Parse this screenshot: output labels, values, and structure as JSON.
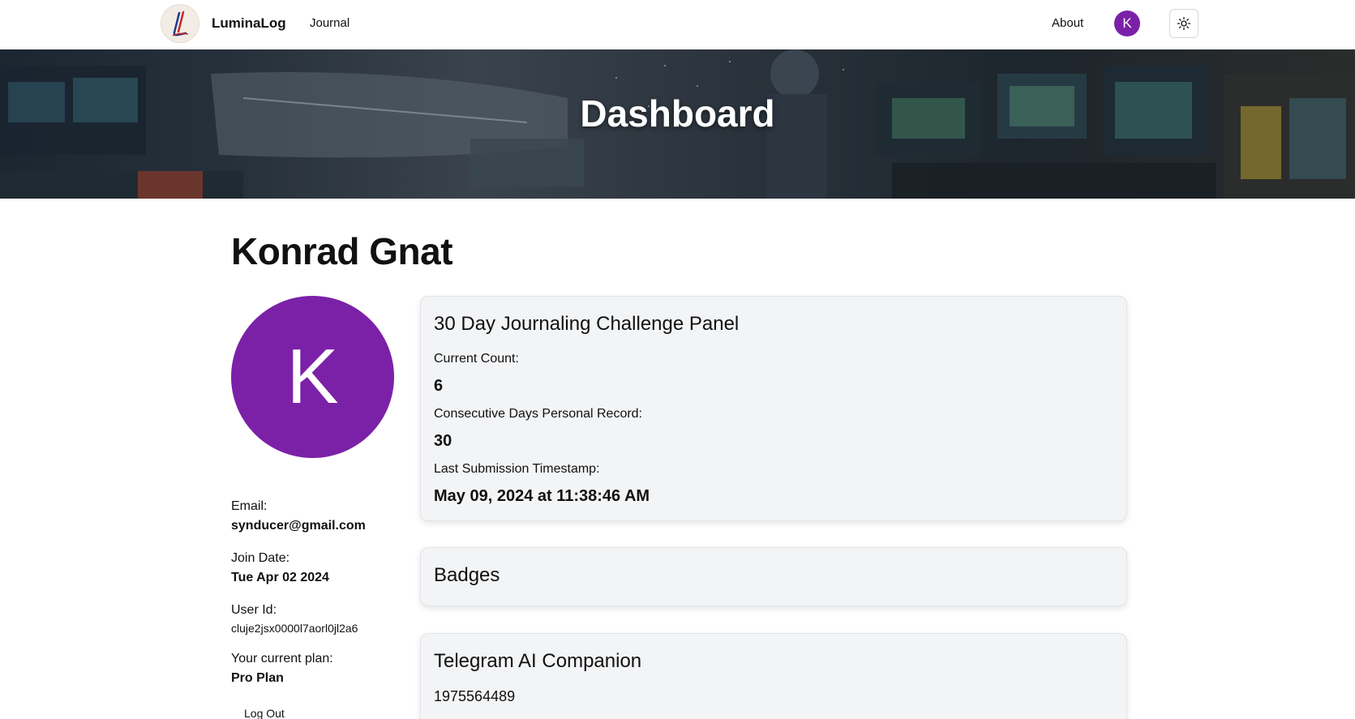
{
  "nav": {
    "brand": "LuminaLog",
    "journal_label": "Journal",
    "about_label": "About",
    "avatar_initial": "K",
    "theme_icon": "sun-icon"
  },
  "hero": {
    "title": "Dashboard"
  },
  "profile": {
    "name": "Konrad Gnat",
    "avatar_initial": "K",
    "avatar_color": "#7b21a8",
    "email_label": "Email:",
    "email": "synducer@gmail.com",
    "join_label": "Join Date:",
    "join_date": "Tue Apr 02 2024",
    "user_id_label": "User Id:",
    "user_id": "cluje2jsx0000l7aorl0jl2a6",
    "plan_label": "Your current plan:",
    "plan": "Pro Plan",
    "logout_label": "Log Out"
  },
  "challenge": {
    "title": "30 Day Journaling Challenge Panel",
    "current_count_label": "Current Count:",
    "current_count": "6",
    "record_label": "Consecutive Days Personal Record:",
    "record": "30",
    "last_submission_label": "Last Submission Timestamp:",
    "last_submission": "May 09, 2024 at 11:38:46 AM"
  },
  "badges": {
    "title": "Badges"
  },
  "telegram": {
    "title": "Telegram AI Companion",
    "chat_id": "1975564489"
  },
  "colors": {
    "accent": "#7b21a8",
    "card_bg": "#f3f4f6"
  }
}
